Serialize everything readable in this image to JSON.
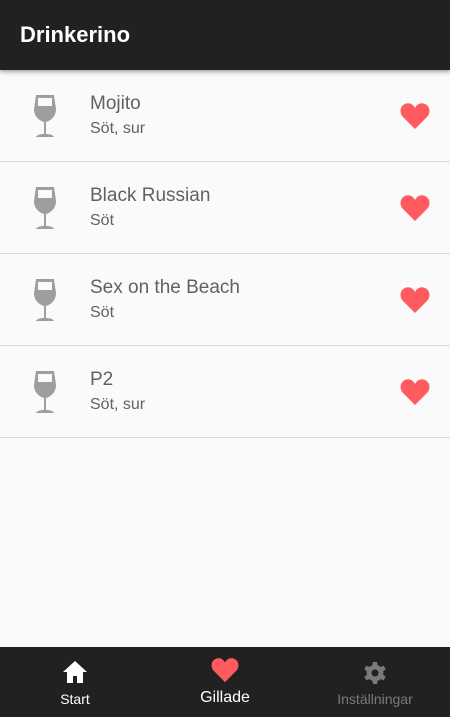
{
  "app": {
    "title": "Drinkerino"
  },
  "drinks": [
    {
      "name": "Mojito",
      "taste": "Söt, sur",
      "icon": "wine-glass-icon",
      "liked": true
    },
    {
      "name": "Black Russian",
      "taste": "Söt",
      "icon": "wine-glass-icon",
      "liked": true
    },
    {
      "name": "Sex on the Beach",
      "taste": "Söt",
      "icon": "wine-glass-icon",
      "liked": true
    },
    {
      "name": "P2",
      "taste": "Söt, sur",
      "icon": "wine-glass-icon",
      "liked": true
    }
  ],
  "nav": {
    "start": {
      "label": "Start",
      "icon": "home-icon"
    },
    "liked": {
      "label": "Gillade",
      "icon": "heart-icon",
      "active": true
    },
    "settings": {
      "label": "Inställningar",
      "icon": "gear-icon"
    }
  },
  "colors": {
    "app_bar": "#212121",
    "background": "#fafafa",
    "heart": "#ff5a5f",
    "glass": "#9e9e9e",
    "text": "#616161",
    "nav_inactive": "#7a7a7a"
  }
}
